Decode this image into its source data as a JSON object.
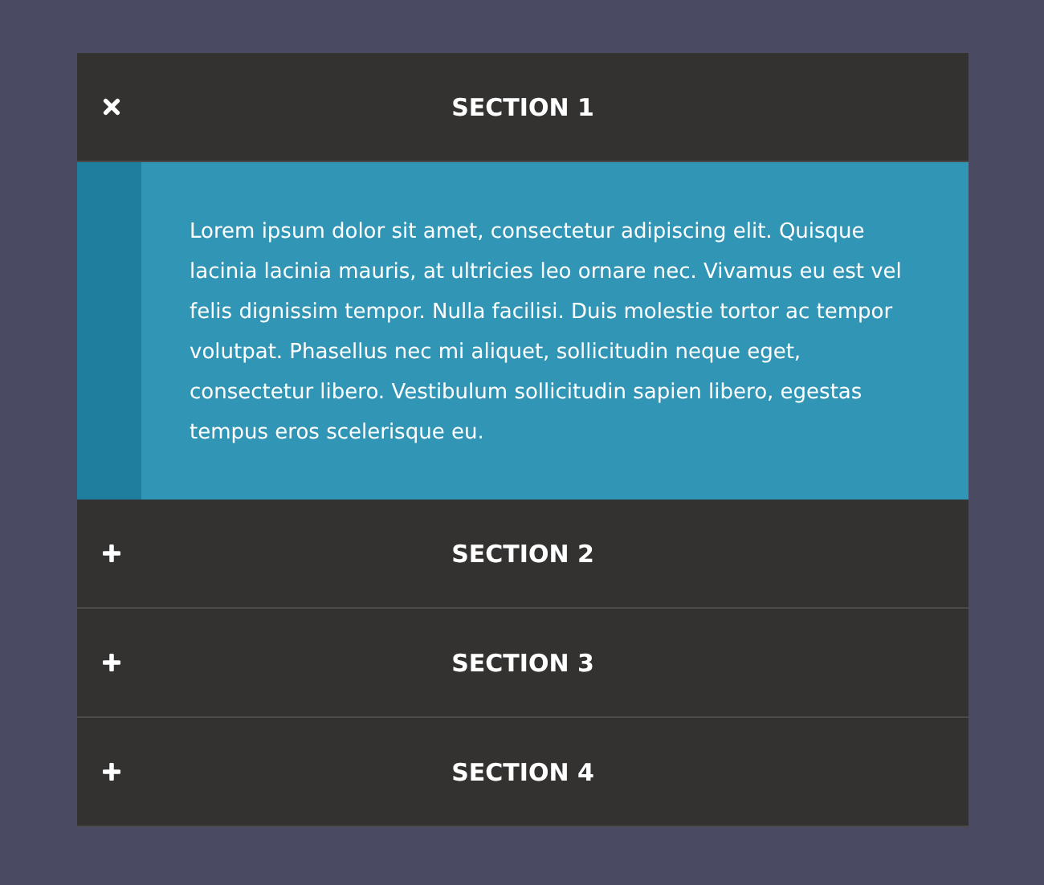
{
  "sections": [
    {
      "title": "SECTION 1",
      "expanded": true,
      "content": "Lorem ipsum dolor sit amet, consectetur adipiscing elit. Quisque lacinia lacinia mauris, at ultricies leo ornare nec. Vivamus eu est vel felis dignissim tempor. Nulla facilisi. Duis molestie tortor ac tempor volutpat. Phasellus nec mi aliquet, sollicitudin neque eget, consectetur libero. Vestibulum sollicitudin sapien libero, egestas tempus eros scelerisque eu."
    },
    {
      "title": "SECTION 2",
      "expanded": false
    },
    {
      "title": "SECTION 3",
      "expanded": false
    },
    {
      "title": "SECTION 4",
      "expanded": false
    }
  ]
}
